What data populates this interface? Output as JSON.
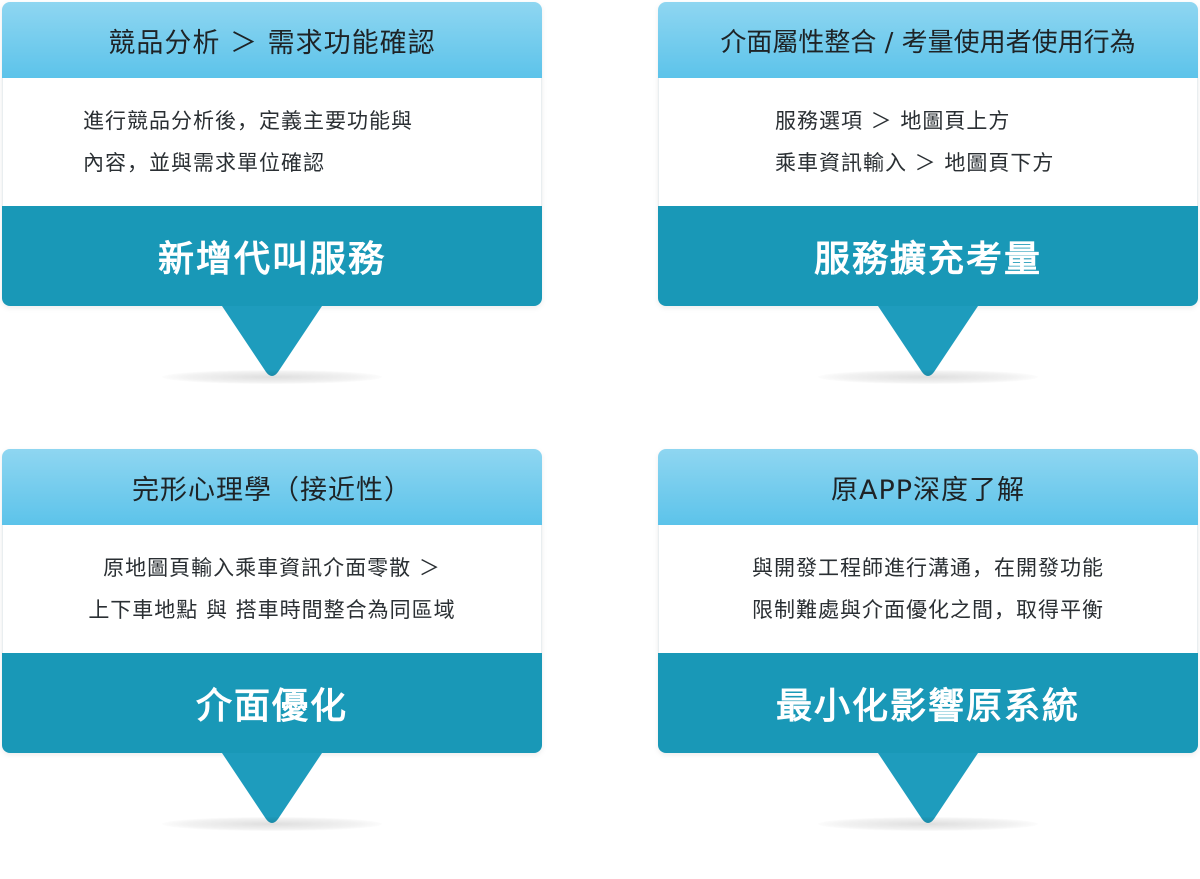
{
  "cards": [
    {
      "header": "競品分析 ＞ 需求功能確認",
      "lines": [
        "進行競品分析後，定義主要功能與",
        "內容，並與需求單位確認"
      ],
      "footer": "新增代叫服務"
    },
    {
      "header": "介面屬性整合 / 考量使用者使用行為",
      "lines": [
        "服務選項 ＞ 地圖頁上方",
        "乘車資訊輸入 ＞ 地圖頁下方"
      ],
      "footer": "服務擴充考量"
    },
    {
      "header": "完形心理學（接近性）",
      "lines": [
        "原地圖頁輸入乘車資訊介面零散 ＞",
        "上下車地點 與 搭車時間整合為同區域"
      ],
      "footer": "介面優化"
    },
    {
      "header": "原APP深度了解",
      "lines": [
        "與開發工程師進行溝通，在開發功能",
        "限制難處與介面優化之間，取得平衡"
      ],
      "footer": "最小化影響原系統"
    }
  ],
  "colors": {
    "header_light": "#8fd6f1",
    "header_dark": "#5cc3ea",
    "footer": "#1998b7",
    "pointer": "#1e9cbd"
  }
}
